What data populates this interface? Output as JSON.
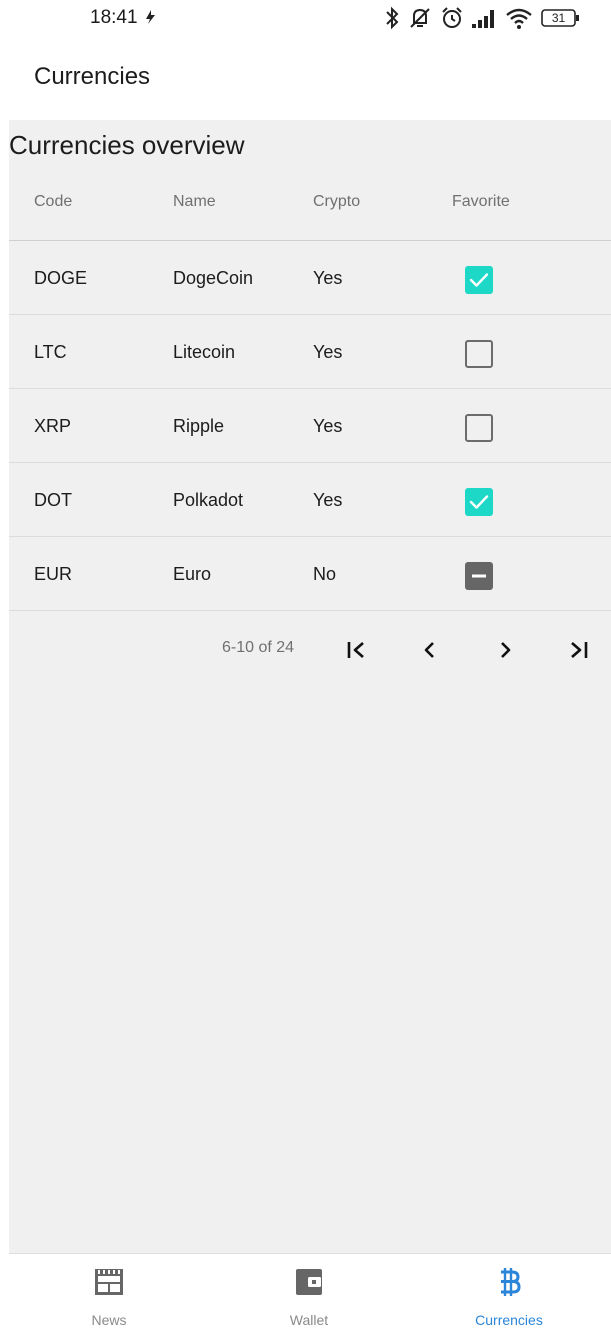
{
  "status_bar": {
    "time": "18:41",
    "battery": "31"
  },
  "app_bar": {
    "title": "Currencies"
  },
  "overview": {
    "title": "Currencies overview",
    "columns": [
      "Code",
      "Name",
      "Crypto",
      "Favorite"
    ],
    "rows": [
      {
        "code": "DOGE",
        "name": "DogeCoin",
        "crypto": "Yes",
        "favorite": "checked"
      },
      {
        "code": "LTC",
        "name": "Litecoin",
        "crypto": "Yes",
        "favorite": "unchecked"
      },
      {
        "code": "XRP",
        "name": "Ripple",
        "crypto": "Yes",
        "favorite": "unchecked"
      },
      {
        "code": "DOT",
        "name": "Polkadot",
        "crypto": "Yes",
        "favorite": "checked"
      },
      {
        "code": "EUR",
        "name": "Euro",
        "crypto": "No",
        "favorite": "indeterminate"
      }
    ]
  },
  "pagination": {
    "range_label": "6-10 of 24",
    "buttons": [
      "first-page",
      "previous-page",
      "next-page",
      "last-page"
    ]
  },
  "bottom_nav": {
    "items": [
      {
        "label": "News",
        "icon": "news-icon",
        "active": false
      },
      {
        "label": "Wallet",
        "icon": "wallet-icon",
        "active": false
      },
      {
        "label": "Currencies",
        "icon": "bitcoin-icon",
        "active": true
      }
    ]
  },
  "colors": {
    "accent_checkbox": "#1dd8c6",
    "active_nav": "#2b86d9",
    "panel_background": "#f0f0f0"
  }
}
